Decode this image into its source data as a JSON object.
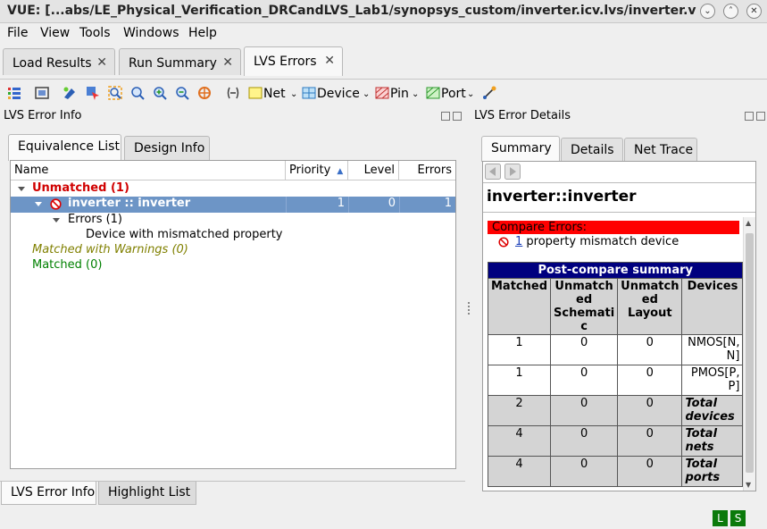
{
  "window": {
    "title": "VUE: [...abs/LE_Physical_Verification_DRCandLVS_Lab1/synopsys_custom/inverter.icv.lvs/inverter.v",
    "minimize_glyph": "⌄",
    "maximize_glyph": "˄",
    "close_glyph": "✕"
  },
  "menu": [
    "File",
    "View",
    "Tools",
    "Windows",
    "Help"
  ],
  "top_tabs": [
    {
      "label": "Load Results",
      "close": "✕"
    },
    {
      "label": "Run Summary",
      "close": "✕"
    },
    {
      "label": "LVS Errors",
      "close": "✕"
    }
  ],
  "toolbar": {
    "net": "Net",
    "device": "Device",
    "pin": "Pin",
    "port": "Port",
    "dropdown_glyph": "⌄"
  },
  "left_panel": {
    "title": "LVS Error Info",
    "tabs": [
      "Equivalence List",
      "Design Info"
    ],
    "columns": [
      "Name",
      "Priority",
      "Level",
      "Errors"
    ],
    "sort_glyph": "▲",
    "unmatched": "Unmatched (1)",
    "inverter_row": {
      "name": "inverter :: inverter",
      "priority": "1",
      "level": "0",
      "errors": "1"
    },
    "errors": "Errors (1)",
    "error_item": "Device with mismatched property",
    "matched_warn": "Matched with Warnings (0)",
    "matched": "Matched (0)",
    "bottom_tabs": [
      "LVS Error Info",
      "Highlight List"
    ]
  },
  "right_panel": {
    "title": "LVS Error Details",
    "tabs": [
      "Summary",
      "Details",
      "Net Trace"
    ],
    "cell_title": "inverter::inverter",
    "compare_errors": "Compare Errors:",
    "error_count": "1",
    "error_text": " property mismatch device",
    "table_title": "Post-compare summary",
    "table_cols": [
      "Matched",
      "Unmatch\ned\nSchemati\nc",
      "Unmatch\ned\nLayout",
      "Devices"
    ],
    "rows": [
      {
        "m": "1",
        "s": "0",
        "l": "0",
        "d": "NMOS[N,\nN]"
      },
      {
        "m": "1",
        "s": "0",
        "l": "0",
        "d": "PMOS[P,\nP]"
      },
      {
        "m": "2",
        "s": "0",
        "l": "0",
        "d": "Total\ndevices"
      },
      {
        "m": "4",
        "s": "0",
        "l": "0",
        "d": "Total\nnets"
      },
      {
        "m": "4",
        "s": "0",
        "l": "0",
        "d": "Total\nports"
      }
    ]
  },
  "status": [
    "L",
    "S"
  ],
  "colors": {
    "selected_row": "#6d95c6",
    "unmatched_red": "#d00000",
    "warn_olive": "#808000",
    "matched_green": "#008000",
    "error_banner": "#ff0000",
    "table_header": "#00007f"
  }
}
